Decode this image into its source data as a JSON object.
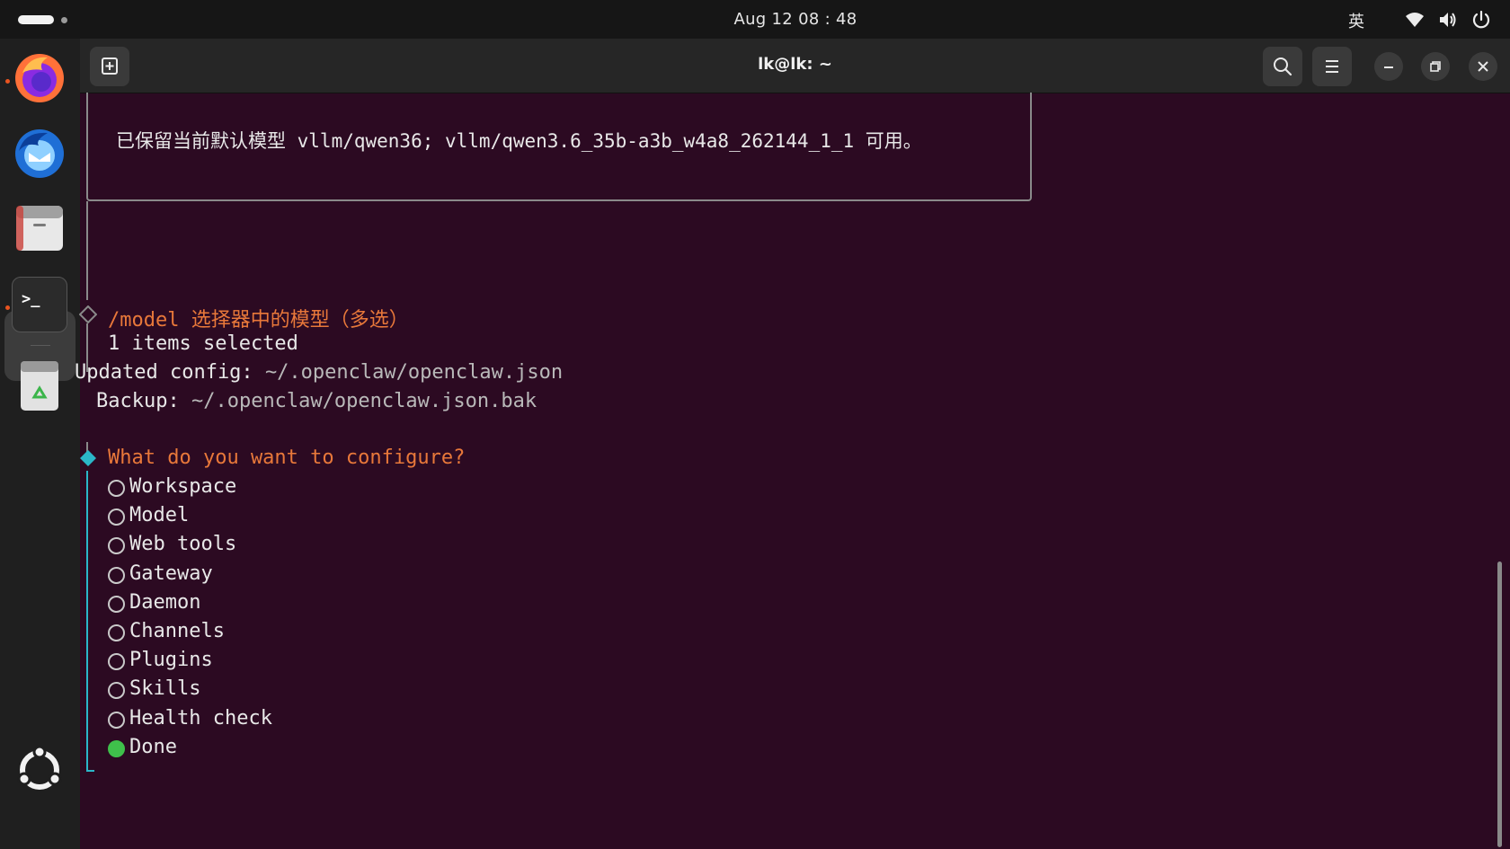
{
  "topbar": {
    "clock": "Aug 12  08 : 48",
    "ime": "英"
  },
  "dock": {
    "items": [
      {
        "name": "firefox-icon"
      },
      {
        "name": "thunderbird-icon"
      },
      {
        "name": "files-icon"
      },
      {
        "name": "terminal-icon",
        "active": true
      },
      {
        "name": "trash-icon"
      },
      {
        "name": "show-apps-icon"
      }
    ],
    "terminal_icon_glyph": ">_"
  },
  "window": {
    "title": "lk@lk: ~"
  },
  "terminal": {
    "box_text": "已保留当前默认模型 vllm/qwen36; vllm/qwen3.6_35b-a3b_w4a8_262144_1_1 可用。",
    "model_prompt": "/model 选择器中的模型（多选）",
    "items_selected": "1 items selected",
    "updated_config_label": "Updated config:",
    "updated_config_path": "~/.openclaw/openclaw.json",
    "backup_label": "Backup:",
    "backup_path": "~/.openclaw/openclaw.json.bak",
    "question": "What do you want to configure?",
    "options": [
      {
        "label": "Workspace",
        "selected": false
      },
      {
        "label": "Model",
        "selected": false
      },
      {
        "label": "Web tools",
        "selected": false
      },
      {
        "label": "Gateway",
        "selected": false
      },
      {
        "label": "Daemon",
        "selected": false
      },
      {
        "label": "Channels",
        "selected": false
      },
      {
        "label": "Plugins",
        "selected": false
      },
      {
        "label": "Skills",
        "selected": false
      },
      {
        "label": "Health check",
        "selected": false
      },
      {
        "label": "Done",
        "selected": true
      }
    ]
  },
  "colors": {
    "terminal_bg": "#2c0a22",
    "prompt_orange": "#e8783a",
    "active_diamond": "#2bb6c8",
    "selected_green": "#3fc04b",
    "ubuntu_orange": "#e95420"
  }
}
